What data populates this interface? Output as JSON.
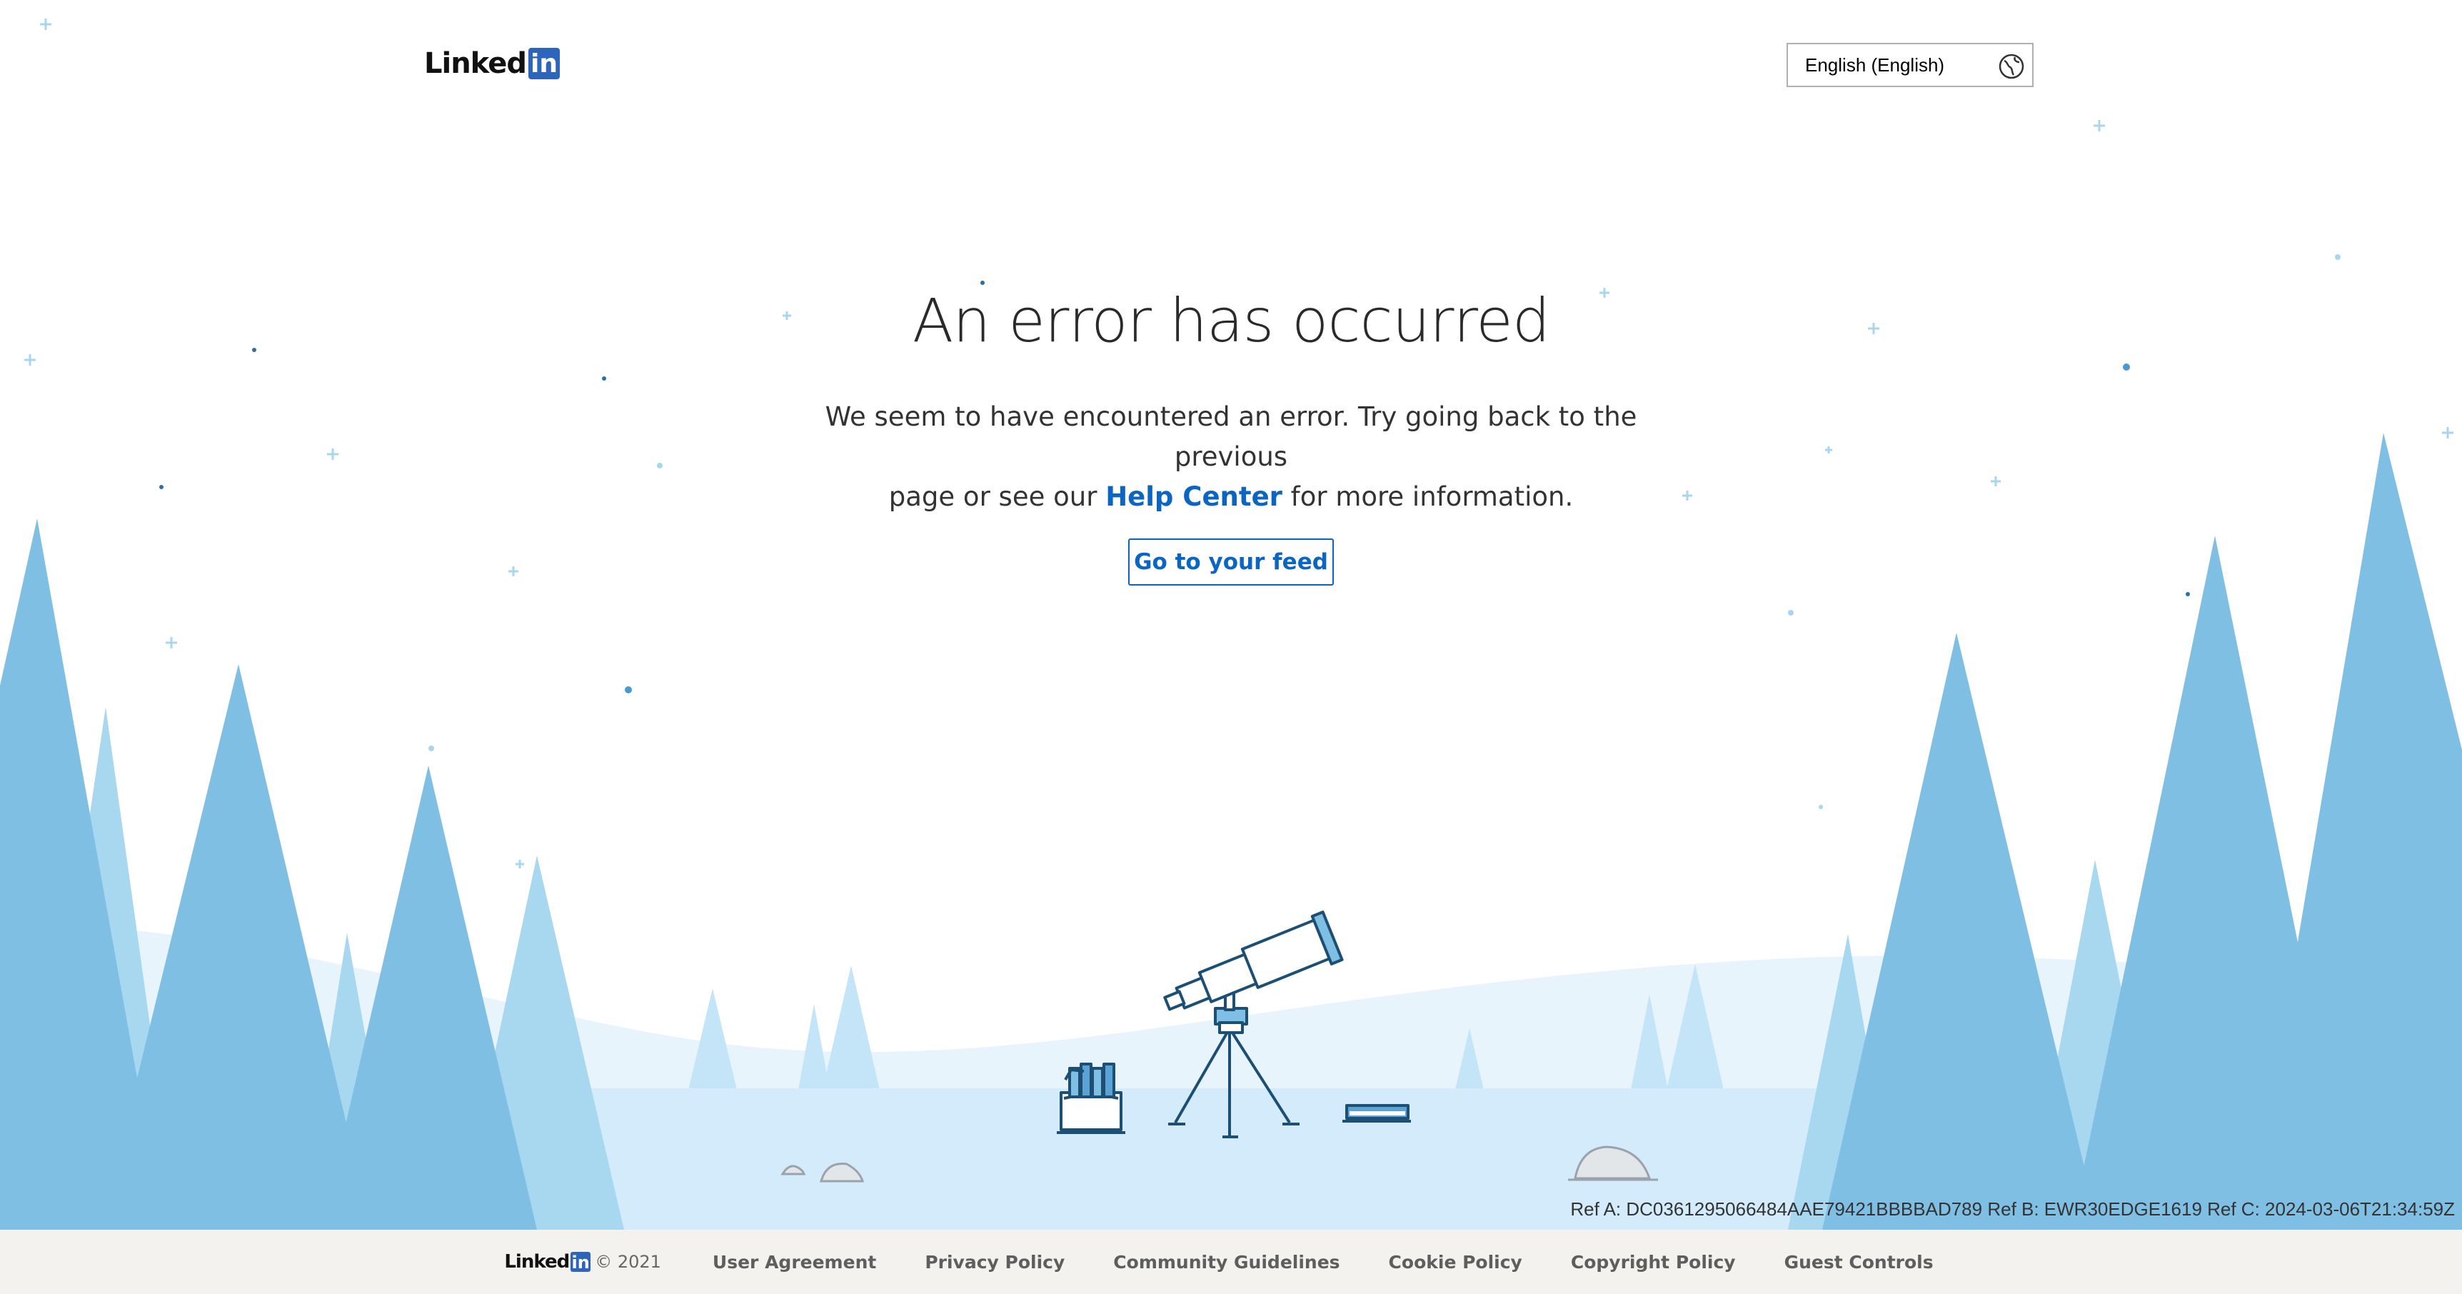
{
  "header": {
    "logo_text": "Linked",
    "logo_box": "in",
    "language": "English (English)"
  },
  "main": {
    "title": "An error has occurred",
    "desc_line1": "We seem to have encountered an error. Try going back to the previous",
    "desc_line2_before": "page or see our ",
    "help_link": "Help Center",
    "desc_line2_after": " for more information.",
    "feed_button": "Go to your feed"
  },
  "ref": "Ref A: DC0361295066484AAE79421BBBBAD789 Ref B: EWR30EDGE1619 Ref C: 2024-03-06T21:34:59Z",
  "footer": {
    "logo_text": "Linked",
    "logo_box": "in",
    "copyright": "© 2021",
    "links": [
      "User Agreement",
      "Privacy Policy",
      "Community Guidelines",
      "Cookie Policy",
      "Copyright Policy",
      "Guest Controls"
    ]
  },
  "colors": {
    "brand_blue": "#0a66c2",
    "logo_blue": "#2d64bc",
    "tree_dark": "#7fbfe3",
    "tree_light": "#a8d7f0",
    "ground": "#d3ebfa",
    "footer_bg": "#f3f2ef"
  },
  "icons": {
    "language_select": "globe-icon",
    "illustration": "telescope-illustration"
  }
}
